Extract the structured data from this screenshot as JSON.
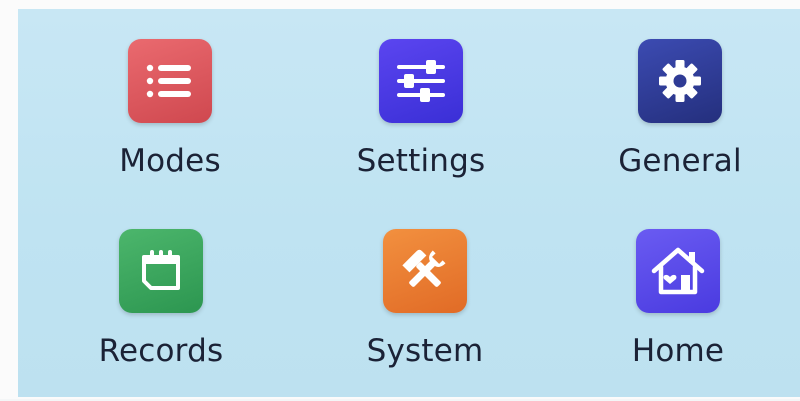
{
  "menu": {
    "items": [
      {
        "label": "Modes",
        "icon": "list-icon",
        "color": "#d9545a"
      },
      {
        "label": "Settings",
        "icon": "sliders-icon",
        "color": "#4a3be6"
      },
      {
        "label": "General",
        "icon": "gear-icon",
        "color": "#2f3b95"
      },
      {
        "label": "Records",
        "icon": "calendar-icon",
        "color": "#3aa55d"
      },
      {
        "label": "System",
        "icon": "hammer-wrench-icon",
        "color": "#ea7c30"
      },
      {
        "label": "Home",
        "icon": "house-heart-icon",
        "color": "#5546ea"
      }
    ]
  }
}
